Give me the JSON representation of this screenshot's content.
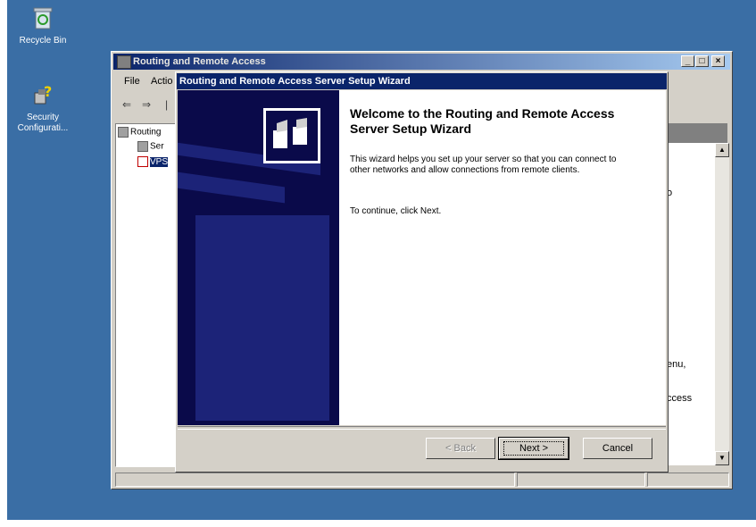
{
  "desktop": {
    "icons": [
      {
        "label": "Recycle Bin",
        "icon": "recycle-bin-icon"
      },
      {
        "label": "Security Configurati...",
        "icon": "security-config-icon"
      }
    ]
  },
  "mmc": {
    "title": "Routing and Remote Access",
    "menu": [
      "File",
      "Actio"
    ],
    "tree": [
      {
        "label": "Routing"
      },
      {
        "label": "Ser"
      },
      {
        "label": "VPS"
      }
    ],
    "right_pane_fragments": [
      "o",
      "enu,",
      "ccess"
    ]
  },
  "wizard": {
    "title": "Routing and Remote Access Server Setup Wizard",
    "heading": "Welcome to the Routing and Remote Access Server Setup Wizard",
    "paragraph1": "This wizard helps you set up your server so that you can connect to other networks and allow connections from remote clients.",
    "paragraph2": "To continue, click Next.",
    "buttons": {
      "back": "< Back",
      "next": "Next >",
      "cancel": "Cancel"
    }
  },
  "colors": {
    "desktop": "#3a6ea5",
    "wizard_title": "#0a246a",
    "wizard_side": "#0a0a4a"
  }
}
